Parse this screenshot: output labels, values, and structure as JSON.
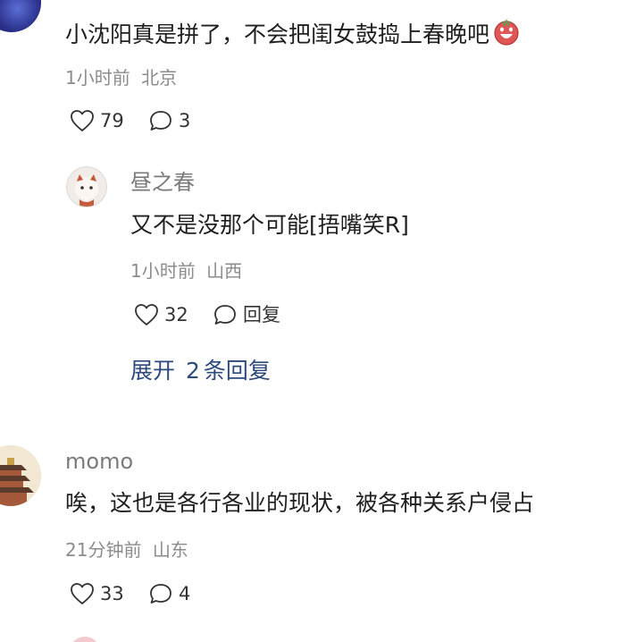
{
  "comments": [
    {
      "text": "小沈阳真是拼了，不会把闺女鼓捣上春晚吧",
      "emoji_icon": "grinning-face-emoji-icon",
      "time": "1小时前",
      "location": "北京",
      "likes": "79",
      "replies": "3"
    },
    {
      "username": "momo",
      "text": "唉，这也是各行各业的现状，被各种关系户侵占",
      "time": "21分钟前",
      "location": "山东",
      "likes": "33",
      "replies": "4"
    }
  ],
  "reply": {
    "username": "昼之春",
    "text": "又不是没那个可能[捂嘴笑R]",
    "time": "1小时前",
    "location": "山西",
    "likes": "32",
    "reply_label": "回复"
  },
  "expand_replies": {
    "label_prefix": "展开",
    "count": "2",
    "label_suffix": "条回复"
  },
  "colors": {
    "link_blue": "#2c4a7b",
    "meta_gray": "#8c8c8c"
  }
}
